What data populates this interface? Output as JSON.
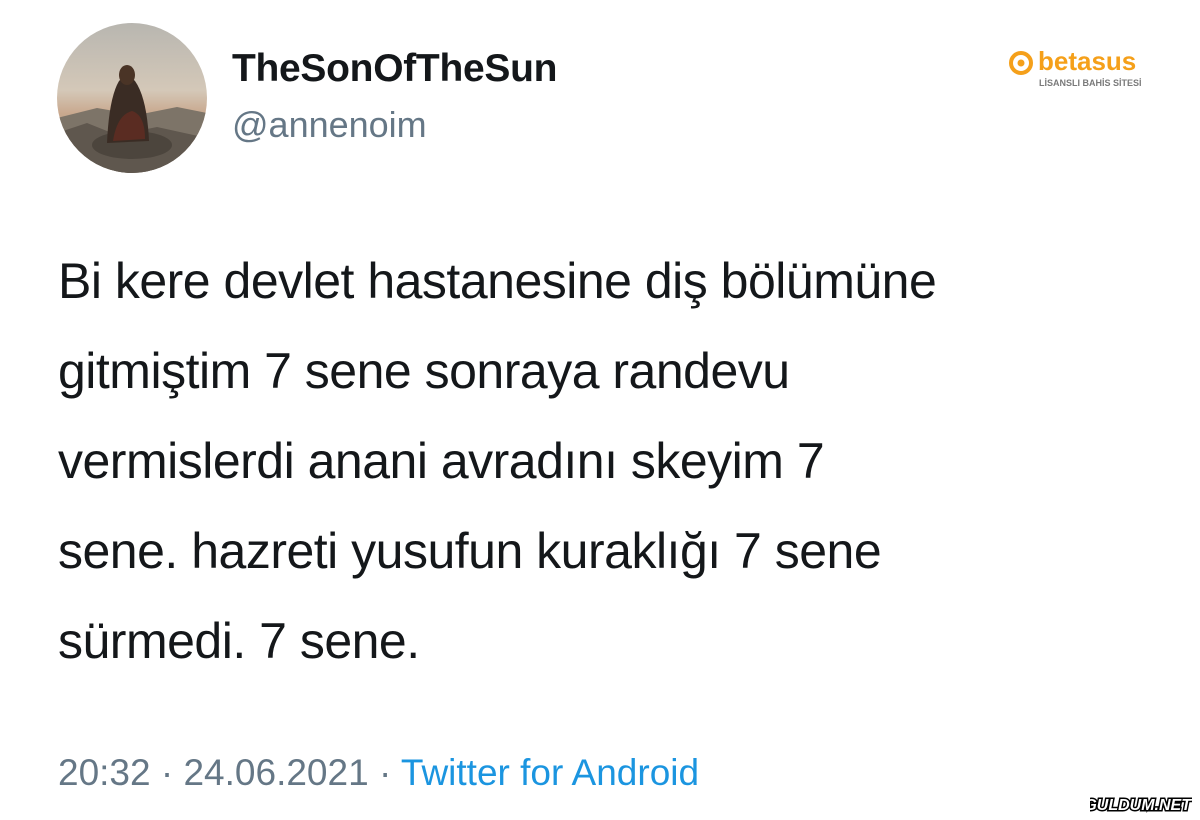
{
  "user": {
    "display_name": "TheSonOfTheSun",
    "handle": "@annenoim",
    "avatar_icon": "painting-avatar-icon"
  },
  "tweet": {
    "lines": [
      "Bi kere devlet hastanesine diş bölümüne",
      "gitmiştim 7 sene sonraya randevu",
      "vermislerdi anani avradını skeyim 7",
      "sene. hazreti yusufun kuraklığı 7 sene",
      "sürmedi. 7 sene."
    ],
    "time": "20:32",
    "separator_1": " · ",
    "date": "24.06.2021",
    "separator_2": " · ",
    "source": "Twitter for Android"
  },
  "watermarks": {
    "top_right_logo": {
      "brand": "betasus",
      "tagline": "LİSANSLI BAHİS SİTESİ",
      "icon": "orange-ring-icon",
      "color": "#f5a01a"
    },
    "bottom_right": {
      "text": "GULDUM.NET",
      "color": "#000000"
    }
  },
  "colors": {
    "text_primary": "#14171a",
    "text_secondary": "#657786",
    "link": "#1b95e0",
    "background": "#ffffff"
  }
}
